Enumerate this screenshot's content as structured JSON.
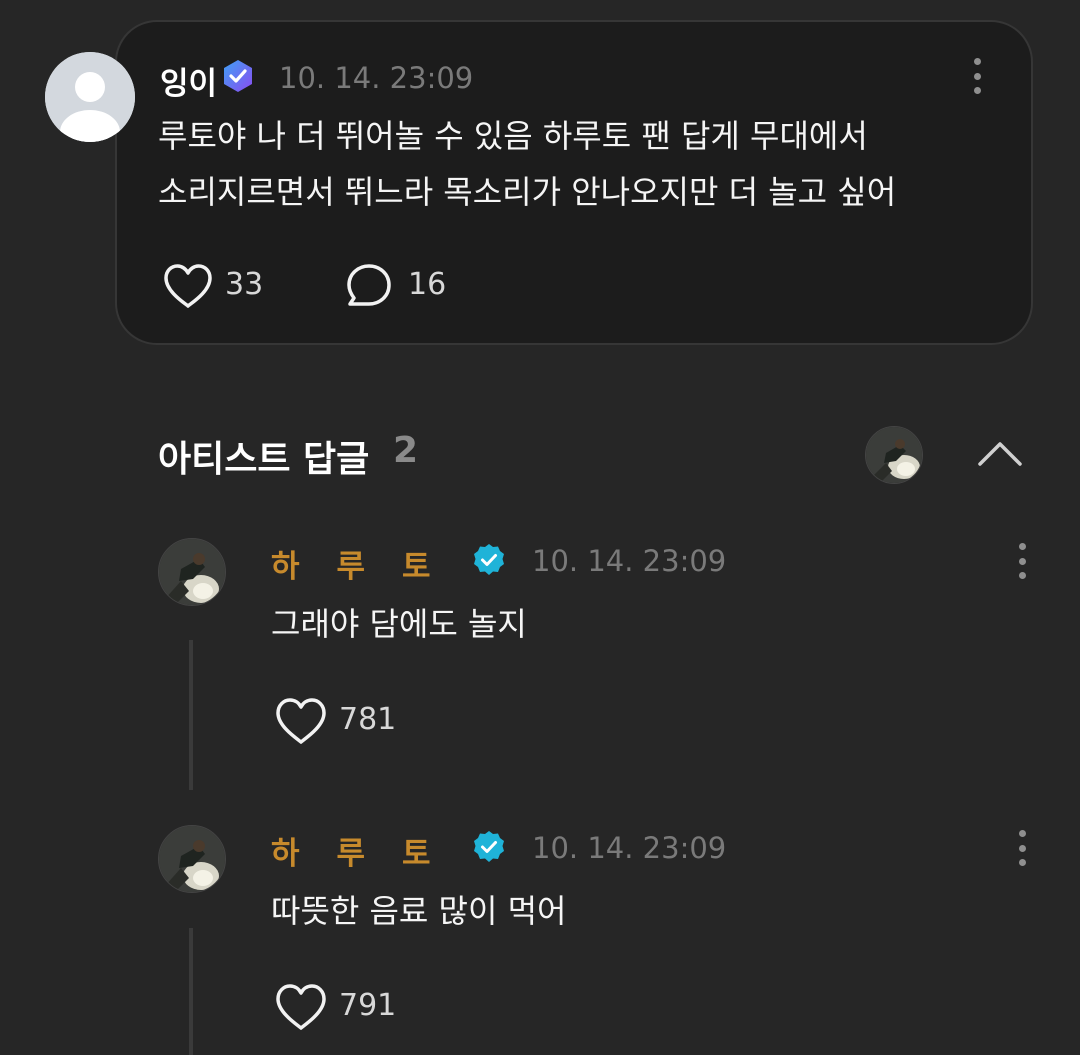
{
  "post": {
    "author": "잉이",
    "time": "10. 14. 23:09",
    "text_line1": "루토야 나 더 뛰어놀 수 있음 하루토 팬 답게 무대에서",
    "text_line2": "소리지르면서 뛰느라 목소리가 안나오지만 더 놀고 싶어",
    "likes": "33",
    "comments": "16"
  },
  "section": {
    "title": "아티스트 답글",
    "count": "2"
  },
  "replies": [
    {
      "author": "하루토",
      "time": "10. 14. 23:09",
      "text": "그래야 담에도 놀지",
      "likes": "781"
    },
    {
      "author": "하루토",
      "time": "10. 14. 23:09",
      "text": "따뜻한 음료 많이 먹어",
      "likes": "791"
    }
  ],
  "colors": {
    "background": "#262626",
    "card": "#1c1c1c",
    "artist_name": "#c78a2c",
    "verified_blue": "#1fb3d8",
    "verified_purple": "#7b5cf0"
  },
  "icons": [
    "heart-icon",
    "comment-bubble-icon",
    "more-vert-icon",
    "chevron-up-icon",
    "verified-badge-icon",
    "default-avatar-icon"
  ]
}
